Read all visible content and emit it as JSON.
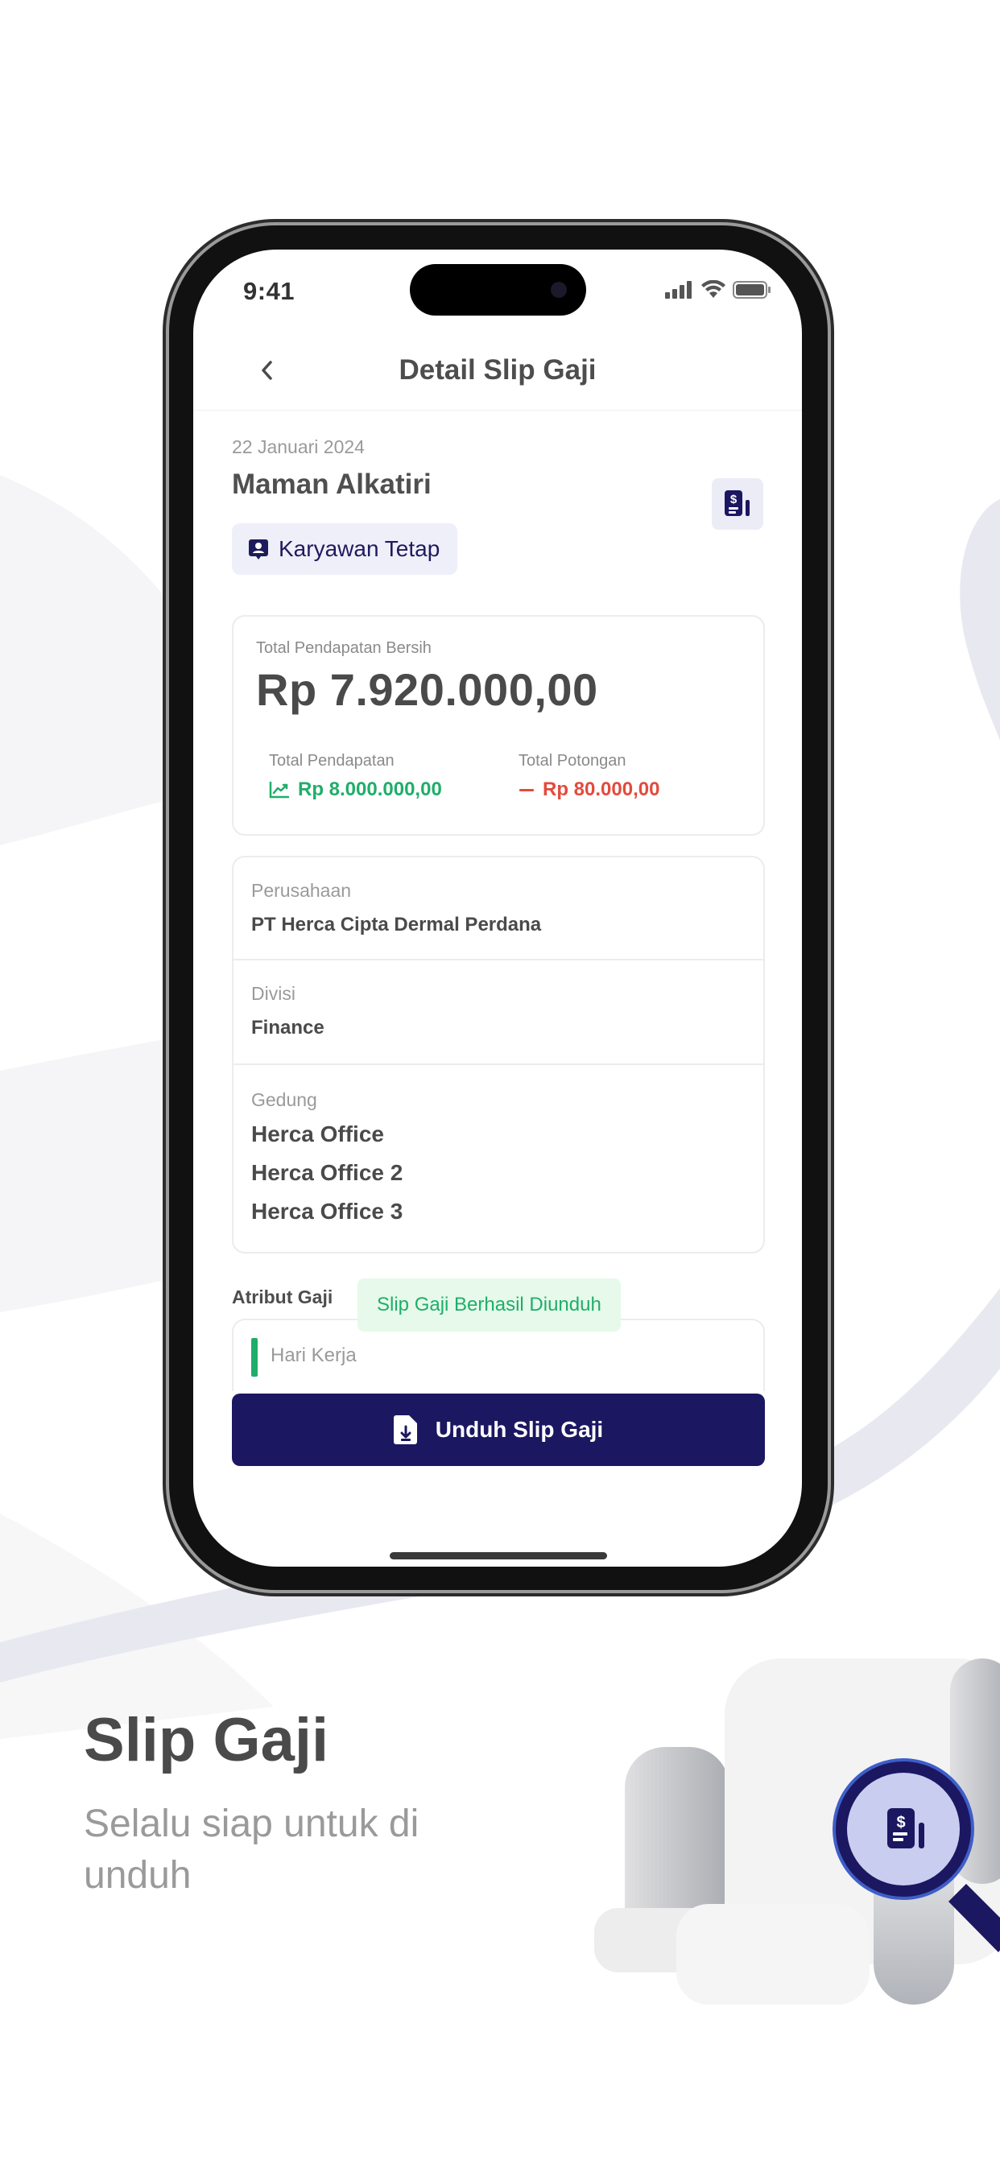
{
  "status_bar": {
    "time": "9:41"
  },
  "header": {
    "title": "Detail Slip Gaji"
  },
  "employee": {
    "date": "22 Januari 2024",
    "name": "Maman Alkatiri",
    "status_badge": "Karyawan Tetap"
  },
  "income": {
    "net_label": "Total Pendapatan Bersih",
    "net_value": "Rp 7.920.000,00",
    "gross_label": "Total Pendapatan",
    "gross_value": "Rp 8.000.000,00",
    "deduction_label": "Total Potongan",
    "deduction_value": "Rp 80.000,00"
  },
  "info": {
    "company_label": "Perusahaan",
    "company_value": "PT Herca Cipta Dermal Perdana",
    "division_label": "Divisi",
    "division_value": "Finance",
    "building_label": "Gedung",
    "buildings": [
      "Herca Office",
      "Herca Office 2",
      "Herca Office 3"
    ]
  },
  "salary_attributes": {
    "label": "Atribut Gaji",
    "items": [
      "Hari Kerja"
    ]
  },
  "toast": {
    "message": "Slip Gaji Berhasil Diunduh"
  },
  "actions": {
    "download_label": "Unduh Slip Gaji"
  },
  "promo": {
    "title": "Slip Gaji",
    "subtitle": "Selalu siap untuk di unduh"
  },
  "colors": {
    "primary": "#1c1761",
    "success": "#1fae6a",
    "danger": "#e44a3c",
    "badge_bg": "#efeffa",
    "toast_bg": "#e6f9ea"
  },
  "icons": {
    "back": "chevron-left-icon",
    "slip": "document-dollar-icon",
    "badge": "id-badge-icon",
    "trend": "trend-up-icon",
    "minus": "minus-icon",
    "download": "file-download-icon",
    "illustration": "magnifier-slip-icon"
  }
}
